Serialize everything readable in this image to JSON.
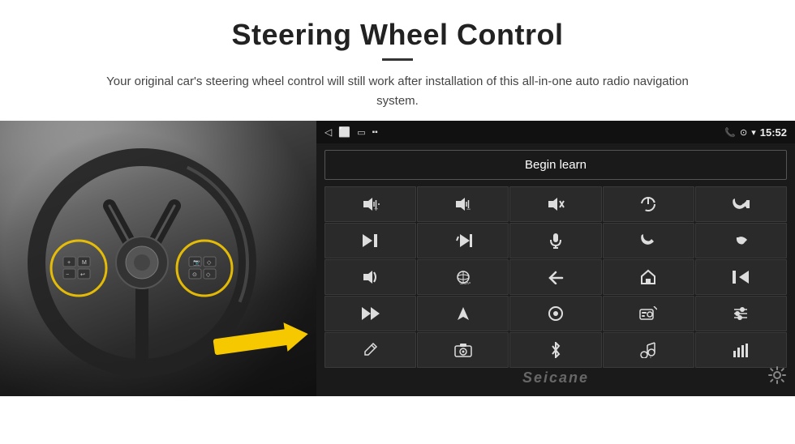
{
  "header": {
    "title": "Steering Wheel Control",
    "subtitle": "Your original car's steering wheel control will still work after installation of this all-in-one auto radio navigation system."
  },
  "status_bar": {
    "back_icon": "◁",
    "home_icon": "⬜",
    "recent_icon": "▭",
    "signal_icon": "📶",
    "phone_icon": "📞",
    "location_icon": "⊙",
    "wifi_icon": "▾",
    "time": "15:52"
  },
  "begin_learn": {
    "label": "Begin learn"
  },
  "buttons": [
    {
      "icon": "🔊+",
      "label": "vol-up"
    },
    {
      "icon": "🔊−",
      "label": "vol-down"
    },
    {
      "icon": "🔇",
      "label": "mute"
    },
    {
      "icon": "⏻",
      "label": "power"
    },
    {
      "icon": "📞⏮",
      "label": "phone-prev"
    },
    {
      "icon": "⏭",
      "label": "next"
    },
    {
      "icon": "⏮⏭",
      "label": "skip"
    },
    {
      "icon": "🎤",
      "label": "mic"
    },
    {
      "icon": "📞",
      "label": "call"
    },
    {
      "icon": "↩",
      "label": "hang-up"
    },
    {
      "icon": "📢",
      "label": "speaker"
    },
    {
      "icon": "360°",
      "label": "360-cam"
    },
    {
      "icon": "↩",
      "label": "back"
    },
    {
      "icon": "🏠",
      "label": "home"
    },
    {
      "icon": "⏮⏮",
      "label": "prev-track"
    },
    {
      "icon": "⏭⏭",
      "label": "fast-fwd"
    },
    {
      "icon": "▶",
      "label": "nav"
    },
    {
      "icon": "⏺",
      "label": "source"
    },
    {
      "icon": "📻",
      "label": "radio"
    },
    {
      "icon": "≡↕",
      "label": "equalizer"
    },
    {
      "icon": "✏",
      "label": "edit"
    },
    {
      "icon": "⊙",
      "label": "camera"
    },
    {
      "icon": "✱",
      "label": "bluetooth"
    },
    {
      "icon": "♪",
      "label": "music"
    },
    {
      "icon": "|||",
      "label": "volume-bar"
    }
  ],
  "watermark": {
    "text": "Seicane"
  },
  "colors": {
    "background": "#1a1a1a",
    "button_bg": "#2a2a2a",
    "button_border": "#3a3a3a",
    "text": "#ddd",
    "status_bar": "#111",
    "yellow": "#f5c800"
  },
  "button_icons": {
    "row1": [
      "🔊＋",
      "🔊－",
      "🔇",
      "⏻",
      "📞⏮"
    ],
    "row2": [
      "⏭",
      "⏮",
      "🎙",
      "☎",
      "↩"
    ],
    "row3": [
      "📢",
      "360",
      "↩",
      "⌂",
      "⏮⏮"
    ],
    "row4": [
      "⏭⏭",
      "▲",
      "⏺",
      "📻",
      "⣿"
    ],
    "row5": [
      "✏",
      "◎",
      "✱",
      "♫",
      "▶▶"
    ]
  }
}
